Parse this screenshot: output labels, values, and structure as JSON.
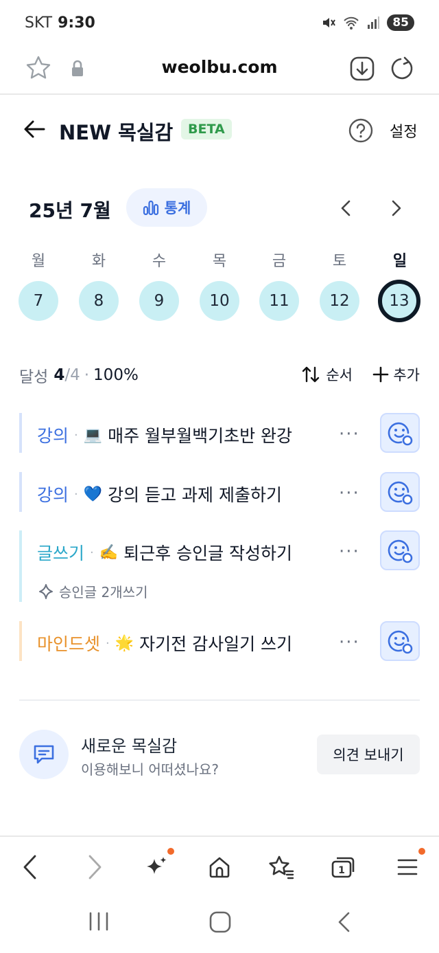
{
  "status_bar": {
    "carrier": "SKT",
    "time": "9:30",
    "battery": "85"
  },
  "browser": {
    "domain": "weolbu.com"
  },
  "header": {
    "title": "NEW 목실감",
    "badge": "BETA",
    "settings": "설정"
  },
  "calendar": {
    "month": "25년 7월",
    "stats_label": "통계",
    "weekdays": [
      "월",
      "화",
      "수",
      "목",
      "금",
      "토",
      "일"
    ],
    "days": [
      "7",
      "8",
      "9",
      "10",
      "11",
      "12",
      "13"
    ],
    "selected_day": "13"
  },
  "summary": {
    "label": "달성",
    "count": "4",
    "total": "/4",
    "dot": "·",
    "percent": "100%",
    "order_label": "순서",
    "add_label": "추가"
  },
  "tasks": [
    {
      "category": "강의",
      "category_color": "#3b6fe0",
      "bar_color": "#d6e2fb",
      "emoji": "💻",
      "text": "매주 월부월백기초반 완강"
    },
    {
      "category": "강의",
      "category_color": "#3b6fe0",
      "bar_color": "#d6e2fb",
      "emoji": "💙",
      "text": "강의 듣고 과제 제출하기"
    },
    {
      "category": "글쓰기",
      "category_color": "#2aa7c9",
      "bar_color": "#cdeef7",
      "emoji": "✍️",
      "text": "퇴근후 승인글 작성하기",
      "sub": "승인글 2개쓰기"
    },
    {
      "category": "마인드셋",
      "category_color": "#e8912a",
      "bar_color": "#fde3c4",
      "emoji": "🌟",
      "text": "자기전 감사일기 쓰기"
    }
  ],
  "feedback": {
    "title": "새로운 목실감",
    "subtitle": "이용해보니 어떠셨나요?",
    "button": "의견 보내기"
  },
  "colors": {
    "accent": "#3b6fe0",
    "day_bg": "#c9eff4",
    "badge_green": "#2f9a4b",
    "notification": "#f26a2b"
  }
}
